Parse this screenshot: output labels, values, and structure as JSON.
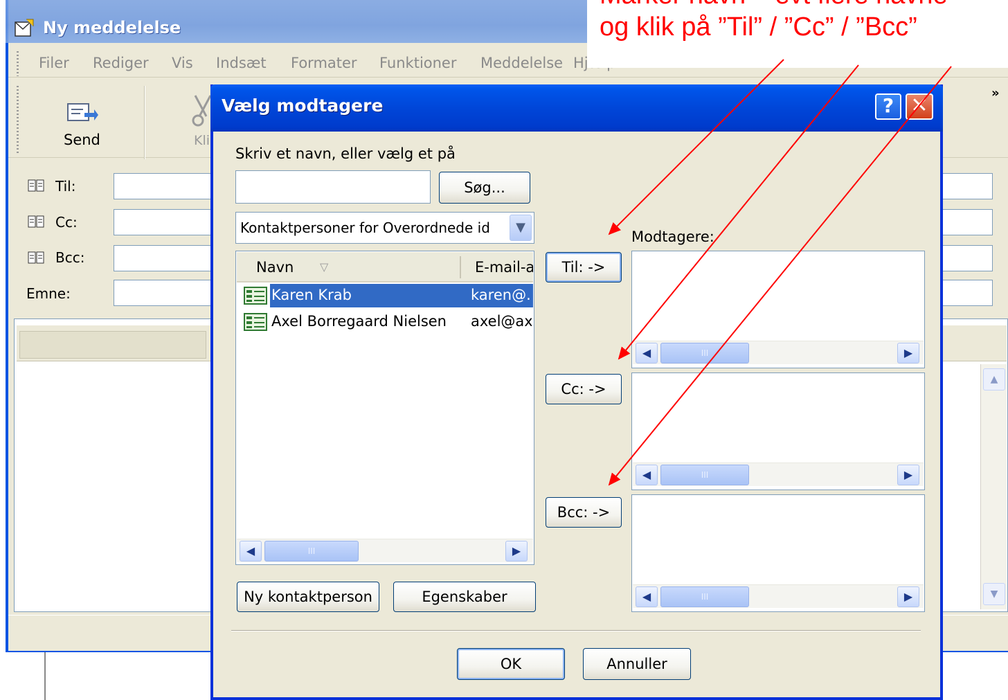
{
  "mail_window": {
    "title": "Ny meddelelse",
    "menu": [
      "Filer",
      "Rediger",
      "Vis",
      "Indsæt",
      "Formater",
      "Funktioner",
      "Meddelelse",
      "Hjælp"
    ],
    "toolbar": {
      "send_label": "Send",
      "cut_label": "Kli"
    },
    "fields": {
      "to_label": "Til:",
      "cc_label": "Cc:",
      "bcc_label": "Bcc:",
      "subject_label": "Emne:"
    }
  },
  "annotation": {
    "line1": "Marker navn – evt flere navne",
    "line2": "og klik på ”Til” / ”Cc” / ”Bcc”",
    "color": "#ff0000"
  },
  "dialog": {
    "title": "Vælg modtagere",
    "help_label": "?",
    "close_label": "✕",
    "prompt": "Skriv et navn, eller vælg et på",
    "search_value": "",
    "search_button": "Søg...",
    "address_book": "Kontaktpersoner for Overordnede id",
    "columns": {
      "name": "Navn",
      "email": "E-mail-a"
    },
    "contacts": [
      {
        "name": "Karen Krab",
        "email": "karen@.",
        "selected": true
      },
      {
        "name": "Axel Borregaard Nielsen",
        "email": "axel@ax",
        "selected": false
      }
    ],
    "recipients_label": "Modtagere:",
    "to_button": "Til: ->",
    "cc_button": "Cc: ->",
    "bcc_button": "Bcc: ->",
    "new_contact_button": "Ny kontaktperson",
    "properties_button": "Egenskaber",
    "ok_button": "OK",
    "cancel_button": "Annuller",
    "scroll_thumb_glyph": "III",
    "selection_color": "#316ac5"
  }
}
